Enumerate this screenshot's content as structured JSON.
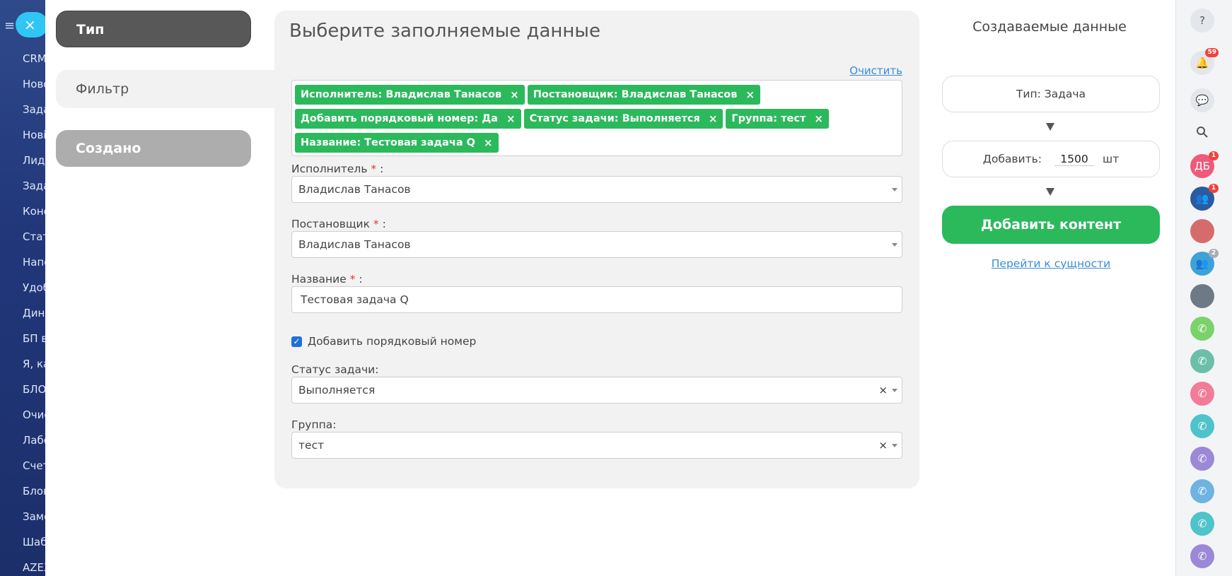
{
  "left_nav": {
    "close_icon": "×",
    "items": [
      "CRM",
      "Ново",
      "Зада",
      "Нові",
      "Лиды",
      "Зада",
      "Конс",
      "Стат",
      "Напо",
      "Удоб",
      "Дина",
      "БП в",
      "Я, ка",
      "БЛО",
      "Очис",
      "Лабо",
      "Счет",
      "Блок",
      "Заме",
      "Шаб",
      "AZEX"
    ]
  },
  "steps": {
    "type": "Тип",
    "filter": "Фильтр",
    "created": "Создано"
  },
  "main": {
    "title": "Выберите заполняемые данные",
    "clear_link": "Очистить",
    "tags": [
      "Исполнитель: Владислав Танасов",
      "Постановщик: Владислав Танасов",
      "Добавить порядковый номер: Да",
      "Статус задачи: Выполняется",
      "Группа: тест",
      "Название: Тестовая задача Q"
    ],
    "tag_remove": "×",
    "required_mark": "*",
    "fields": {
      "executor_label": "Исполнитель",
      "executor_value": "Владислав Танасов",
      "creator_label": "Постановщик",
      "creator_value": "Владислав Танасов",
      "name_label": "Название",
      "name_value": "Тестовая задача Q",
      "seq_label": "Добавить порядковый номер",
      "seq_checked": true,
      "status_label": "Статус задачи:",
      "status_value": "Выполняется",
      "group_label": "Группа:",
      "group_value": "тест",
      "label_suffix": " :"
    }
  },
  "summary": {
    "title": "Создаваемые данные",
    "type_line": "Тип: Задача",
    "add_label": "Добавить:",
    "add_qty": "1500",
    "add_unit": "шт",
    "button": "Добавить контент",
    "goto_link": "Перейти к сущности"
  },
  "right_rail": {
    "help": "?",
    "notifications_badge": "59",
    "avatar_initials": "ДБ",
    "badges": {
      "db": "1",
      "group": "1",
      "team": "2"
    },
    "colors": {
      "db": "#ef5a7a",
      "group": "#2a5aa0",
      "team": "#3ea2d6",
      "phone_green": "#7bd26a",
      "phone_teal": "#6bbfa8",
      "phone_pink": "#f07c97",
      "phone_cyan": "#4ec3c9",
      "phone_purple": "#9b88d6",
      "phone_blue": "#6fb3e0"
    }
  },
  "colors": {
    "accent_green": "#2bb95c",
    "link_blue": "#3c8dd5",
    "required_red": "#e0392b"
  }
}
